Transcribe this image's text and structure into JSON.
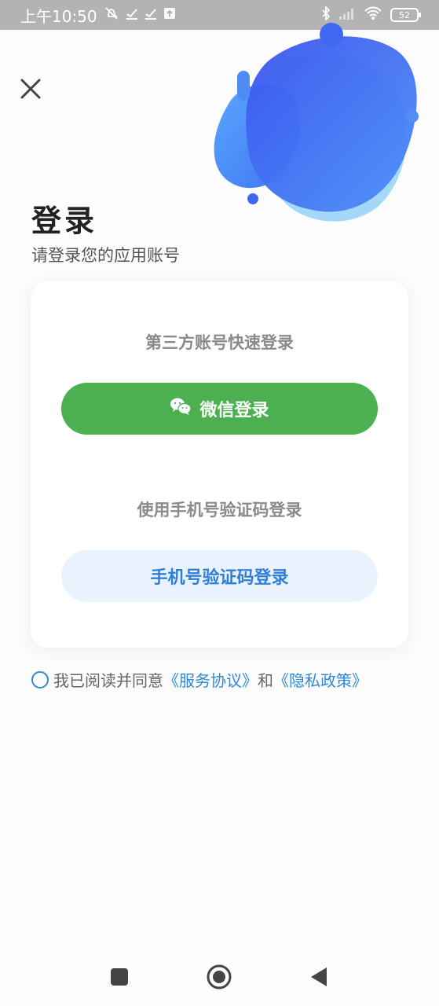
{
  "status_bar": {
    "time": "上午10:50",
    "battery": "52",
    "icons": [
      "mute-icon",
      "check-icon",
      "check-icon",
      "upload-icon",
      "bluetooth-icon",
      "signal-icon",
      "wifi-icon",
      "battery-icon"
    ]
  },
  "header": {
    "title": "登录",
    "subtitle": "请登录您的应用账号"
  },
  "card": {
    "third_party_label": "第三方账号快速登录",
    "wechat_button": "微信登录",
    "phone_label": "使用手机号验证码登录",
    "phone_button": "手机号验证码登录"
  },
  "agreement": {
    "prefix": "我已阅读并同意",
    "service_link": "《服务协议》",
    "and": "和",
    "privacy_link": "《隐私政策》",
    "checked": false
  },
  "colors": {
    "wechat_green": "#4caf50",
    "link_blue": "#2e89d6",
    "phone_button_bg": "#eaf3fd",
    "blob_blue": "#3d63f0"
  }
}
